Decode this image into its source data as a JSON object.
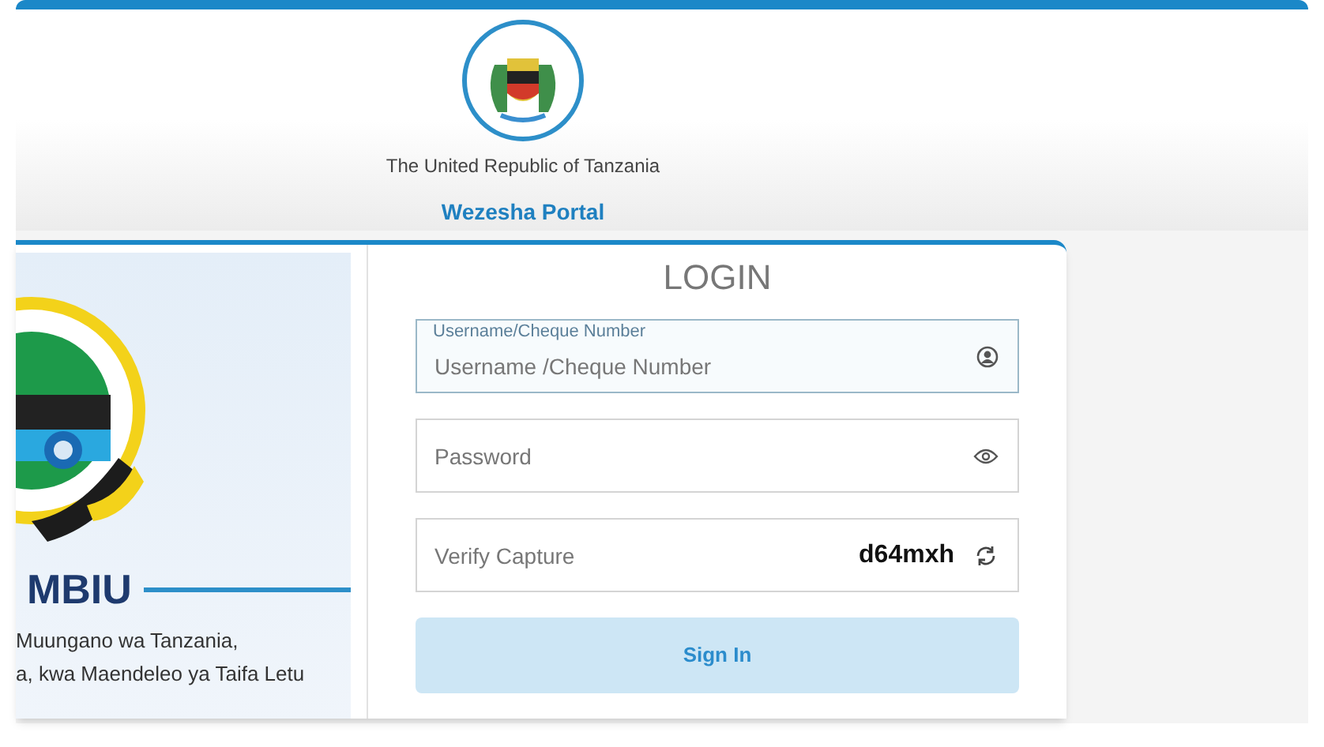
{
  "header": {
    "country": "The United Republic of Tanzania",
    "portal": "Wezesha Portal"
  },
  "banner": {
    "heading": "MBIU",
    "lines": [
      "Muungano wa Tanzania,",
      "a, kwa Maendeleo ya Taifa Letu"
    ]
  },
  "login": {
    "title": "LOGIN",
    "fields": [
      {
        "kind": "username",
        "label": "Username/Cheque Number",
        "placeholder": "Username /Cheque Number",
        "focused": true
      },
      {
        "kind": "password",
        "placeholder": "Password",
        "focused": false
      },
      {
        "kind": "captcha",
        "placeholder": "Verify Capture",
        "code": "d64mxh",
        "focused": false
      }
    ],
    "button": "Sign In"
  }
}
